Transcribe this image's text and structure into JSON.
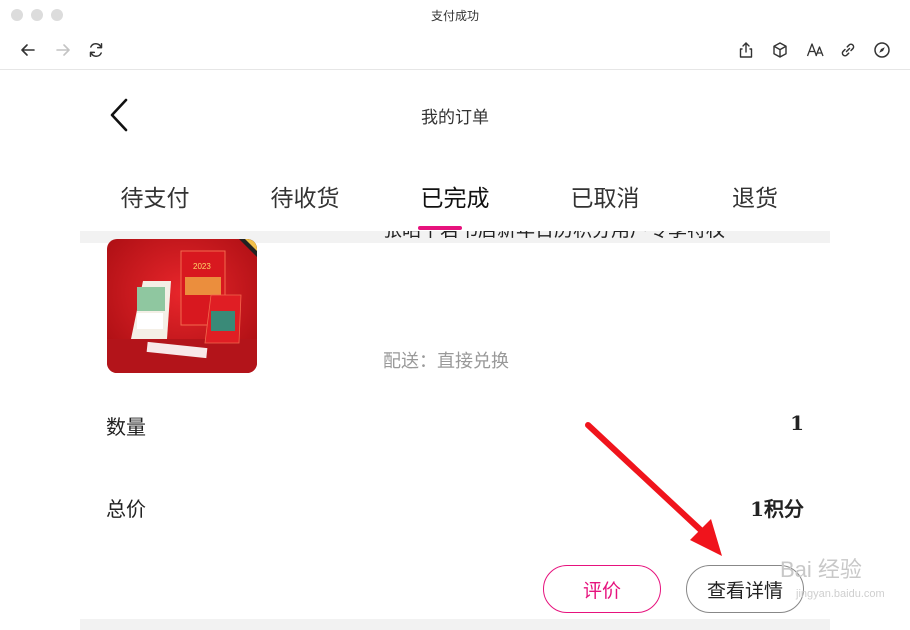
{
  "window": {
    "title": "支付成功"
  },
  "browser": {
    "back_icon": "arrow-left-icon",
    "forward_icon": "arrow-right-icon",
    "reload_icon": "reload-icon",
    "share_icon": "share-icon",
    "cube_icon": "cube-icon",
    "text_size_icon": "text-size-icon",
    "link_icon": "link-icon",
    "compass_icon": "compass-icon"
  },
  "header": {
    "title": "我的订单",
    "back_icon": "chevron-left-icon"
  },
  "tabs": [
    {
      "label": "待支付"
    },
    {
      "label": "待收货"
    },
    {
      "label": "已完成",
      "active": true
    },
    {
      "label": "已取消"
    },
    {
      "label": "退货"
    }
  ],
  "order": {
    "product_name": "张昭平君书店新年日历积分用户专享特权",
    "delivery": "配送：直接兑换",
    "quantity_label": "数量",
    "quantity_value": "1",
    "total_label": "总价",
    "total_value": "1积分",
    "review_button": "评价",
    "detail_button": "查看详情"
  },
  "colors": {
    "accent": "#e6127d",
    "annotation": "#f0141c"
  },
  "watermark": {
    "text": "Bai 经验",
    "sub": "jingyan.baidu.com"
  }
}
